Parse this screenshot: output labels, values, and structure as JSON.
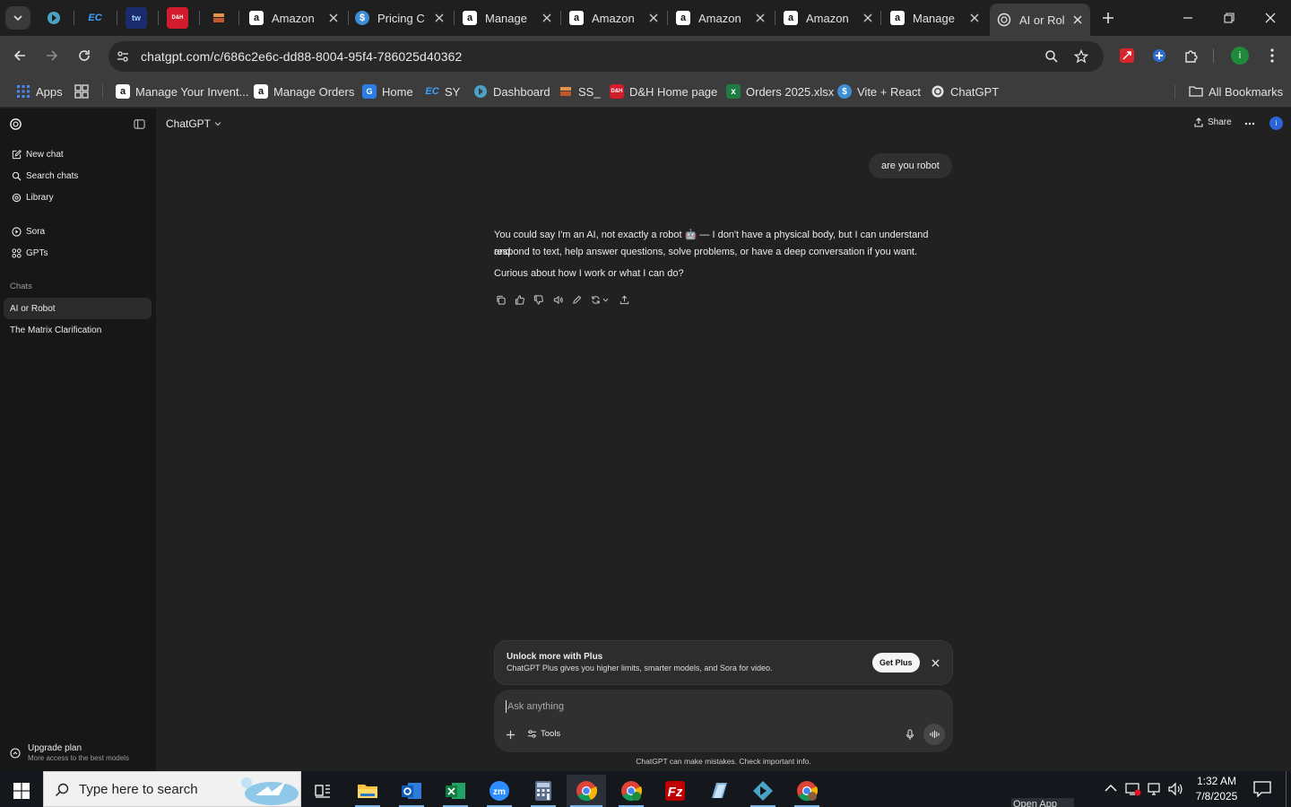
{
  "browser": {
    "pinned_tabs": [
      {
        "icon": "kiwi-icon"
      },
      {
        "label": "EC"
      },
      {
        "label": "tw"
      },
      {
        "label": "D&H"
      },
      {
        "icon": "boxes-icon"
      }
    ],
    "tabs": [
      {
        "title": "Amazon"
      },
      {
        "title": "Pricing C"
      },
      {
        "title": "Manage"
      },
      {
        "title": "Amazon"
      },
      {
        "title": "Amazon"
      },
      {
        "title": "Amazon"
      },
      {
        "title": "Manage"
      },
      {
        "title": "AI or Rol",
        "active": true
      }
    ],
    "url": "chatgpt.com/c/686c2e6c-dd88-8004-95f4-786025d40362",
    "bookmarks": [
      "Apps",
      "Manage Your Invent...",
      "Manage Orders",
      "Home",
      "SY",
      "Dashboard",
      "SS_",
      "D&H Home page",
      "Orders 2025.xlsx",
      "Vite + React",
      "ChatGPT"
    ],
    "all_bookmarks": "All Bookmarks",
    "profile_initial": "i"
  },
  "sidebar": {
    "top_items": [
      "New chat",
      "Search chats",
      "Library"
    ],
    "mid_items": [
      "Sora",
      "GPTs"
    ],
    "chats_heading": "Chats",
    "chats": [
      "AI or Robot",
      "The Matrix Clarification"
    ],
    "upgrade_title": "Upgrade plan",
    "upgrade_sub": "More access to the best models"
  },
  "header": {
    "model": "ChatGPT",
    "share": "Share"
  },
  "conversation": {
    "user_message": "are you robot",
    "reply_line1": "You could say I'm an AI, not exactly a robot 🤖 — I don't have a physical body, but I can understand and",
    "reply_line2": "respond to text, help answer questions, solve problems, or have a deep conversation if you want.",
    "reply_line3": "Curious about how I work or what I can do?"
  },
  "promo": {
    "title": "Unlock more with Plus",
    "body": "ChatGPT Plus gives you higher limits, smarter models, and Sora for video.",
    "button": "Get Plus"
  },
  "composer": {
    "placeholder": "Ask anything",
    "tools": "Tools"
  },
  "disclaimer": "ChatGPT can make mistakes. Check important info.",
  "taskbar": {
    "search_placeholder": "Type here to search",
    "time": "1:32 AM",
    "date": "7/8/2025",
    "tooltip_fragment": "Open App"
  }
}
